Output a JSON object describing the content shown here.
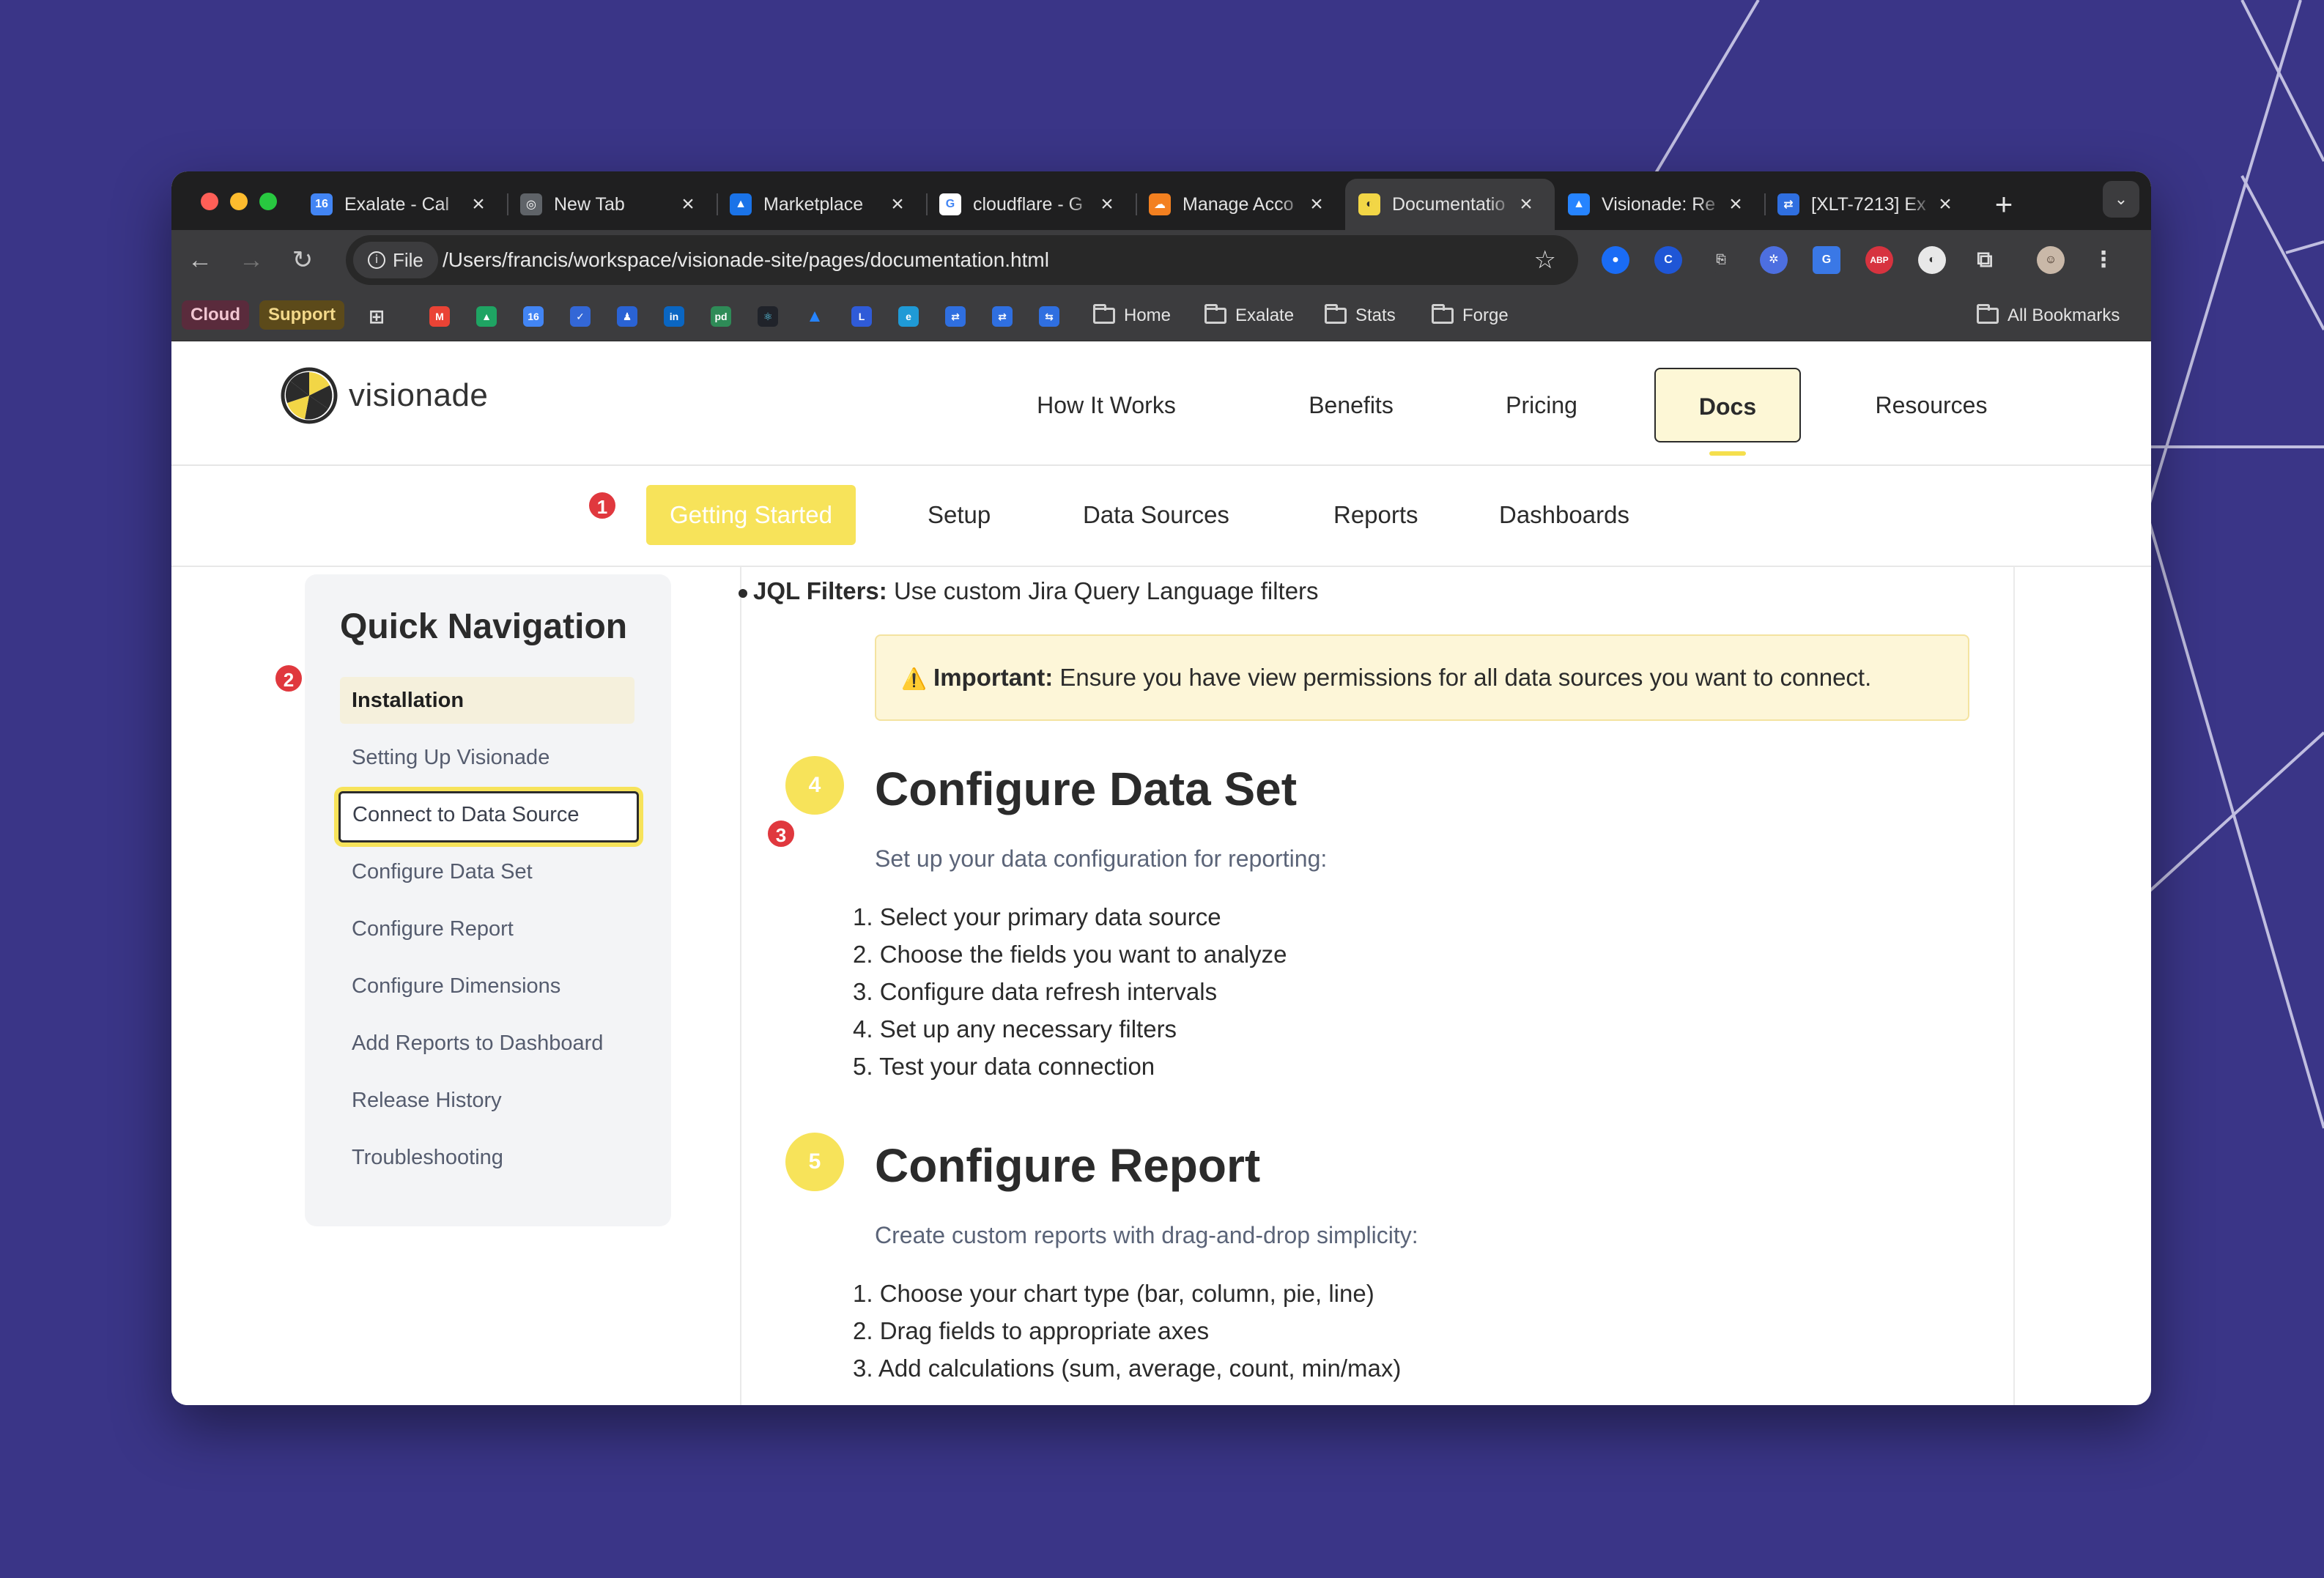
{
  "browser": {
    "tabs": [
      {
        "title": "Exalate - Cal",
        "icon": "calendar-icon",
        "color": "#4285f4",
        "glyph": "16"
      },
      {
        "title": "New Tab",
        "icon": "chrome-icon",
        "color": "#5f6368",
        "glyph": "◎"
      },
      {
        "title": "Marketplace",
        "icon": "google-drive-icon",
        "color": "#1a73e8",
        "glyph": "▲"
      },
      {
        "title": "cloudflare - G",
        "icon": "google-icon",
        "color": "#ffffff",
        "glyph": "G"
      },
      {
        "title": "Manage Acco",
        "icon": "cloudflare-icon",
        "color": "#f38020",
        "glyph": "☁"
      },
      {
        "title": "Documentatio",
        "icon": "visionade-icon",
        "color": "#f2d646",
        "glyph": "◐"
      },
      {
        "title": "Visionade: Re",
        "icon": "atlassian-icon",
        "color": "#2684ff",
        "glyph": "▲"
      },
      {
        "title": "[XLT-7213] Ex",
        "icon": "jira-icon",
        "color": "#2f6fe0",
        "glyph": "⇄"
      }
    ],
    "address": {
      "chip_label": "File",
      "url": "/Users/francis/workspace/visionade-site/pages/documentation.html"
    },
    "bookmarks": {
      "chips": [
        {
          "label": "Cloud",
          "bg": "#5a2b3c",
          "fg": "#f2c6d2"
        },
        {
          "label": "Support",
          "bg": "#5c4a1a",
          "fg": "#f3d98a"
        }
      ],
      "folders": [
        "Home",
        "Exalate",
        "Stats",
        "Forge"
      ],
      "all_bookmarks": "All Bookmarks"
    }
  },
  "site": {
    "logo_text": "visionade",
    "main_nav": [
      "How It Works",
      "Benefits",
      "Pricing",
      "Docs",
      "Resources"
    ],
    "sub_nav": [
      "Getting Started",
      "Setup",
      "Data Sources",
      "Reports",
      "Dashboards"
    ],
    "badges": [
      "1",
      "2",
      "3"
    ],
    "sidebar": {
      "title": "Quick Navigation",
      "items": [
        "Installation",
        "Setting Up Visionade",
        "Connect to Data Source",
        "Configure Data Set",
        "Configure Report",
        "Configure Dimensions",
        "Add Reports to Dashboard",
        "Release History",
        "Troubleshooting"
      ]
    },
    "content": {
      "bullet_bold": "JQL Filters:",
      "bullet_text": " Use custom Jira Query Language filters",
      "warning_icon": "⚠️",
      "warning_bold": "Important:",
      "warning_text": " Ensure you have view permissions for all data sources you want to connect.",
      "section4": {
        "number": "4",
        "title": "Configure Data Set",
        "lead": "Set up your data configuration for reporting:",
        "steps": [
          "1. Select your primary data source",
          "2. Choose the fields you want to analyze",
          "3. Configure data refresh intervals",
          "4. Set up any necessary filters",
          "5. Test your data connection"
        ]
      },
      "section5": {
        "number": "5",
        "title": "Configure Report",
        "lead": "Create custom reports with drag-and-drop simplicity:",
        "steps": [
          "1. Choose your chart type (bar, column, pie, line)",
          "2. Drag fields to appropriate axes",
          "3. Add calculations (sum, average, count, min/max)"
        ]
      }
    },
    "colors": {
      "accent_yellow": "#f7e35a",
      "badge_red": "#e0383e",
      "background": "#3a3587"
    }
  }
}
